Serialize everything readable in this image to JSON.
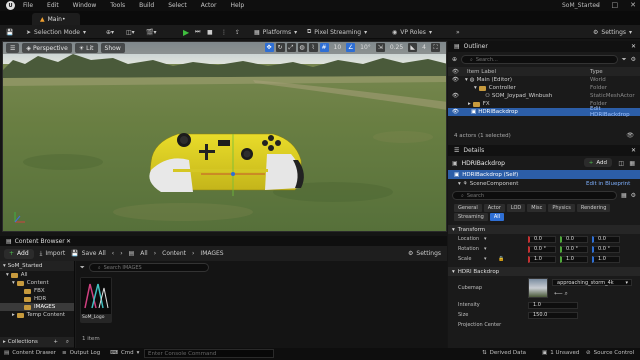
{
  "menu": {
    "items": [
      "File",
      "Edit",
      "Window",
      "Tools",
      "Build",
      "Select",
      "Actor",
      "Help"
    ],
    "project": "SoM_Started"
  },
  "tab": {
    "label": "Main•"
  },
  "toolbar": {
    "selection_mode": "Selection Mode",
    "platforms": "Platforms",
    "pixel_streaming": "Pixel Streaming",
    "vp_roles": "VP Roles",
    "settings": "Settings"
  },
  "viewport": {
    "perspective": "Perspective",
    "lit": "Lit",
    "show": "Show",
    "grid_snap": "10",
    "rot_snap": "10°",
    "scale_snap": "0.25",
    "camera_speed": "4"
  },
  "outliner": {
    "title": "Outliner",
    "search_placeholder": "Search...",
    "col_label": "Item Label",
    "col_type": "Type",
    "rows": [
      {
        "label": "Main (Editor)",
        "type": "World"
      },
      {
        "label": "Controller",
        "type": "Folder"
      },
      {
        "label": "SOM_Joypad_Winbush",
        "type": "StaticMeshActor"
      },
      {
        "label": "FX",
        "type": "Folder"
      },
      {
        "label": "HDRIBackdrop",
        "type": "Edit HDRIBackdrop"
      }
    ],
    "actor_count": "4 actors (1 selected)"
  },
  "details": {
    "title": "Details",
    "actor_name": "HDRIBackdrop",
    "add_label": "Add",
    "self_row": "HDRIBackdrop (Self)",
    "scene_component": "SceneComponent",
    "edit_blueprint": "Edit in Blueprint",
    "search_placeholder": "Search",
    "filters": [
      "General",
      "Actor",
      "LOD",
      "Misc",
      "Physics",
      "Rendering",
      "Streaming",
      "All"
    ],
    "transform_cat": "Transform",
    "location_label": "Location",
    "rotation_label": "Rotation",
    "scale_label": "Scale",
    "location": [
      "0.0",
      "0.0",
      "0.0"
    ],
    "rotation": [
      "0.0 °",
      "0.0 °",
      "0.0 °"
    ],
    "scale": [
      "1.0",
      "1.0",
      "1.0"
    ],
    "hdri_cat": "HDRI Backdrop",
    "cubemap_label": "Cubemap",
    "cubemap_value": "approaching_storm_4k",
    "intensity_label": "Intensity",
    "intensity_value": "1.0",
    "size_label": "Size",
    "size_value": "150.0",
    "projection_label": "Projection Center"
  },
  "content_browser": {
    "tab": "Content Browser",
    "add": "Add",
    "import": "Import",
    "save_all": "Save All",
    "path": [
      "All",
      "Content",
      "IMAGES"
    ],
    "settings": "Settings",
    "project": "SoM_Started",
    "search_placeholder": "Search IMAGES",
    "tree": [
      "All",
      "Content",
      "FBX",
      "HDR",
      "IMAGES",
      "Temp Content"
    ],
    "asset_name": "SoM_Logo",
    "item_count": "1 item",
    "collections": "Collections"
  },
  "statusbar": {
    "content_drawer": "Content Drawer",
    "output_log": "Output Log",
    "cmd": "Cmd",
    "console_placeholder": "Enter Console Command",
    "derived": "Derived Data",
    "unsaved": "1 Unsaved",
    "source": "Source Control"
  }
}
